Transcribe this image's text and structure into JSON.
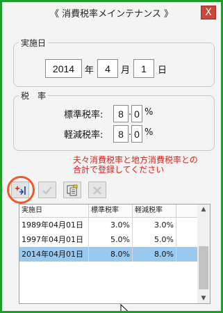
{
  "window": {
    "title": "《 消費税率メインテナンス 》",
    "close_label": "X",
    "border_color": "#1e9c2c"
  },
  "date_group": {
    "label": "実施日",
    "year": "2014",
    "year_unit": "年",
    "month": "4",
    "month_unit": "月",
    "day": "1",
    "day_unit": "日"
  },
  "rate_group": {
    "label": "税　率",
    "standard_label": "標準税率:",
    "standard_int": "8",
    "standard_dec": "0",
    "reduced_label": "軽減税率:",
    "reduced_int": "8",
    "reduced_dec": "0",
    "dot": ".",
    "percent": "%"
  },
  "message": {
    "line1": "夫々消費税率と地方消費税率との",
    "line2": "合計で登録してください",
    "color": "#e0201a"
  },
  "toolbar": {
    "icons": [
      "add-row-icon",
      "check-icon",
      "copy-icon",
      "delete-icon"
    ]
  },
  "table": {
    "headers": [
      "実施日",
      "標準税率",
      "軽減税率"
    ],
    "rows": [
      {
        "date": "1989年04月01日",
        "standard": "3.0%",
        "reduced": "3.0%"
      },
      {
        "date": "1997年04月01日",
        "standard": "5.0%",
        "reduced": "5.0%"
      },
      {
        "date": "2014年04月01日",
        "standard": "8.0%",
        "reduced": "8.0%"
      }
    ],
    "selected_index": 2
  }
}
